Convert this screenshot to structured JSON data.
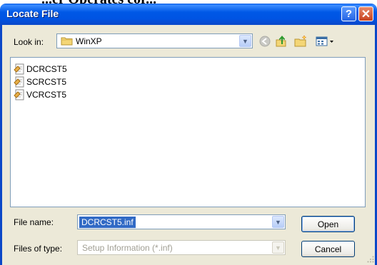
{
  "clipped_heading": "...er Operates cor...",
  "window": {
    "title": "Locate File",
    "help_label": "?",
    "close_label": "✕"
  },
  "lookin": {
    "label": "Look in:",
    "value": "WinXP",
    "icon": "folder-icon"
  },
  "toolbar": {
    "icons": [
      "back-arrow-icon",
      "up-folder-icon",
      "new-folder-icon",
      "view-menu-icon"
    ]
  },
  "files": [
    {
      "name": "DCRCST5",
      "icon": "setup-inf-icon"
    },
    {
      "name": "SCRCST5",
      "icon": "setup-inf-icon"
    },
    {
      "name": "VCRCST5",
      "icon": "setup-inf-icon"
    }
  ],
  "filename": {
    "label": "File name:",
    "value": "DCRCST5.inf"
  },
  "filetype": {
    "label": "Files of type:",
    "value": "Setup Information (*.inf)"
  },
  "buttons": {
    "open": "Open",
    "cancel": "Cancel"
  },
  "colors": {
    "titlebar": "#0054e3",
    "window_bg": "#ece9d8",
    "selection": "#316ac5"
  }
}
